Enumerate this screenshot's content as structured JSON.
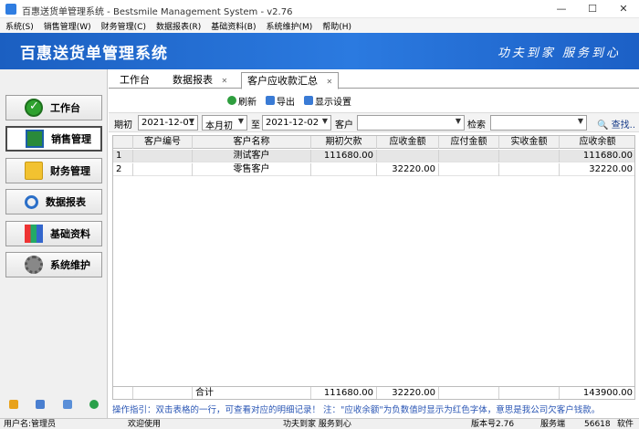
{
  "window": {
    "title": "百惠送货单管理系统 - Bestsmile Management System - v2.76",
    "minimize": "—",
    "maximize": "☐",
    "close": "✕"
  },
  "menu": [
    "系统(S)",
    "销售管理(W)",
    "财务管理(C)",
    "数据报表(R)",
    "基础资料(B)",
    "系统维护(M)",
    "帮助(H)"
  ],
  "banner": {
    "app_name": "百惠送货单管理系统",
    "slogan": "功夫到家 服务到心"
  },
  "sidebar": {
    "items": [
      {
        "label": "工作台",
        "icon": "check-circle-icon"
      },
      {
        "label": "销售管理",
        "icon": "screen-icon"
      },
      {
        "label": "财务管理",
        "icon": "folder-icon"
      },
      {
        "label": "数据报表",
        "icon": "magnifier-icon"
      },
      {
        "label": "基础资料",
        "icon": "blocks-icon"
      },
      {
        "label": "系统维护",
        "icon": "gear-icon"
      }
    ],
    "active_index": 1
  },
  "tabs": [
    {
      "label": "工作台",
      "closable": false
    },
    {
      "label": "数据报表",
      "closable": true
    },
    {
      "label": "客户应收款汇总",
      "closable": true,
      "active": true
    }
  ],
  "toolbar": {
    "refresh": "刷新",
    "export": "导出",
    "display_settings": "显示设置"
  },
  "filter": {
    "period_label": "期初",
    "date_from": "2021-12-01",
    "period_option": "本月初",
    "to_label": "至",
    "date_to": "2021-12-02",
    "customer_label": "客户",
    "customer_value": "",
    "search_label": "检索",
    "search_value": "",
    "query_button": "查找.."
  },
  "grid": {
    "columns": [
      "",
      "客户编号",
      "客户名称",
      "期初欠款",
      "应收金额",
      "应付金额",
      "实收金额",
      "应收余额"
    ],
    "rows": [
      {
        "index": "1",
        "code": "",
        "name": "测试客户",
        "opening": "111680.00",
        "receivable": "",
        "payable": "",
        "received": "",
        "balance": "111680.00"
      },
      {
        "index": "2",
        "code": "",
        "name": "零售客户",
        "opening": "",
        "receivable": "32220.00",
        "payable": "",
        "received": "",
        "balance": "32220.00"
      }
    ],
    "footer": {
      "label": "合计",
      "opening": "111680.00",
      "receivable": "32220.00",
      "payable": "",
      "received": "",
      "balance": "143900.00"
    }
  },
  "hint": "操作指引：双击表格的一行，可查看对应的明细记录！ 注：\"应收余额\"为负数值时显示为红色字体，意思是我公司欠客户钱款。",
  "status": {
    "user": "用户名:管理员",
    "welcome": "欢迎使用",
    "slogan": "功夫到家 服务到心",
    "version": "版本号2.76",
    "server_label": "服务端",
    "port": "56618",
    "soft": "软件"
  },
  "colors": {
    "banner": "#2b7ae0",
    "hint": "#2a56b4"
  }
}
